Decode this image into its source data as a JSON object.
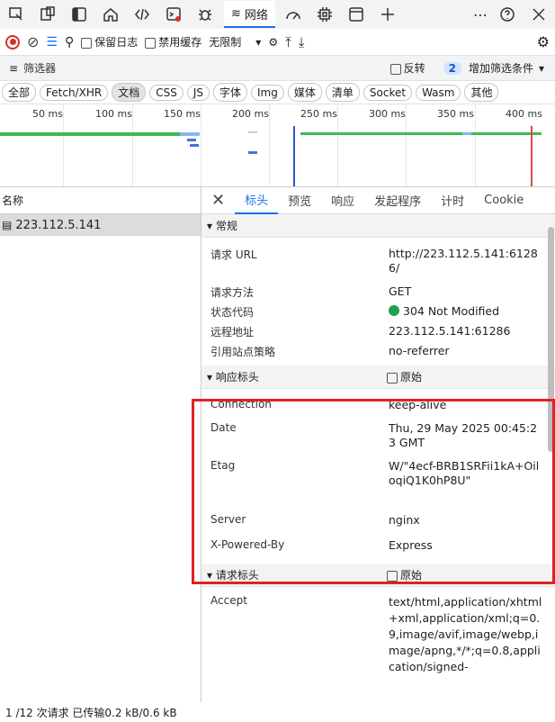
{
  "tabbar": {
    "icons": [
      "inspect-icon",
      "device-icon",
      "sidebar-icon",
      "home-icon",
      "elements-icon",
      "console-icon",
      "sources-icon"
    ],
    "network_label": "网络",
    "more_icons": [
      "performance-icon",
      "memory-icon",
      "application-icon",
      "add-tab-icon"
    ]
  },
  "toolbar": {
    "preserve_log": "保留日志",
    "disable_cache": "禁用缓存",
    "throttle": "无限制"
  },
  "filter": {
    "placeholder": "筛选器",
    "invert": "反转",
    "filter_count": "2",
    "more_filters": "增加筛选条件"
  },
  "types": [
    "全部",
    "Fetch/XHR",
    "文档",
    "CSS",
    "JS",
    "字体",
    "Img",
    "媒体",
    "清单",
    "Socket",
    "Wasm",
    "其他"
  ],
  "timeline": {
    "ticks": [
      "50 ms",
      "100 ms",
      "150 ms",
      "200 ms",
      "250 ms",
      "300 ms",
      "350 ms",
      "400 ms"
    ]
  },
  "left": {
    "header": "名称",
    "request": "223.112.5.141",
    "footer": "1 /12 次请求   已传输0.2 kB/0.6 kB"
  },
  "detail": {
    "tabs": [
      "标头",
      "预览",
      "响应",
      "发起程序",
      "计时",
      "Cookie"
    ],
    "general": {
      "title": "▾ 常规",
      "rows": [
        {
          "k": "请求 URL",
          "v": "http://223.112.5.141:61286/"
        },
        {
          "k": "请求方法",
          "v": "GET"
        },
        {
          "k": "状态代码",
          "v": "304 Not Modified"
        },
        {
          "k": "远程地址",
          "v": "223.112.5.141:61286"
        },
        {
          "k": "引用站点策略",
          "v": "no-referrer"
        }
      ]
    },
    "response": {
      "title": "▾ 响应标头",
      "raw": "原始",
      "rows": [
        {
          "k": "Connection",
          "v": "keep-alive"
        },
        {
          "k": "Date",
          "v": "Thu, 29 May 2025 00:45:23 GMT"
        },
        {
          "k": "Etag",
          "v": "W/\"4ecf-BRB1SRFii1kA+OiloqiQ1K0hP8U\""
        },
        {
          "k": "Server",
          "v": "nginx"
        },
        {
          "k": "X-Powered-By",
          "v": "Express"
        }
      ]
    },
    "request": {
      "title": "▾ 请求标头",
      "raw": "原始",
      "rows": [
        {
          "k": "Accept",
          "v": "text/html,application/xhtml+xml,application/xml;q=0.9,image/avif,image/webp,image/apng,*/*;q=0.8,application/signed-"
        }
      ]
    }
  },
  "colors": {
    "accent": "#1a73e8",
    "status_ok": "#22a04b",
    "highlight_box": "#e02222"
  }
}
